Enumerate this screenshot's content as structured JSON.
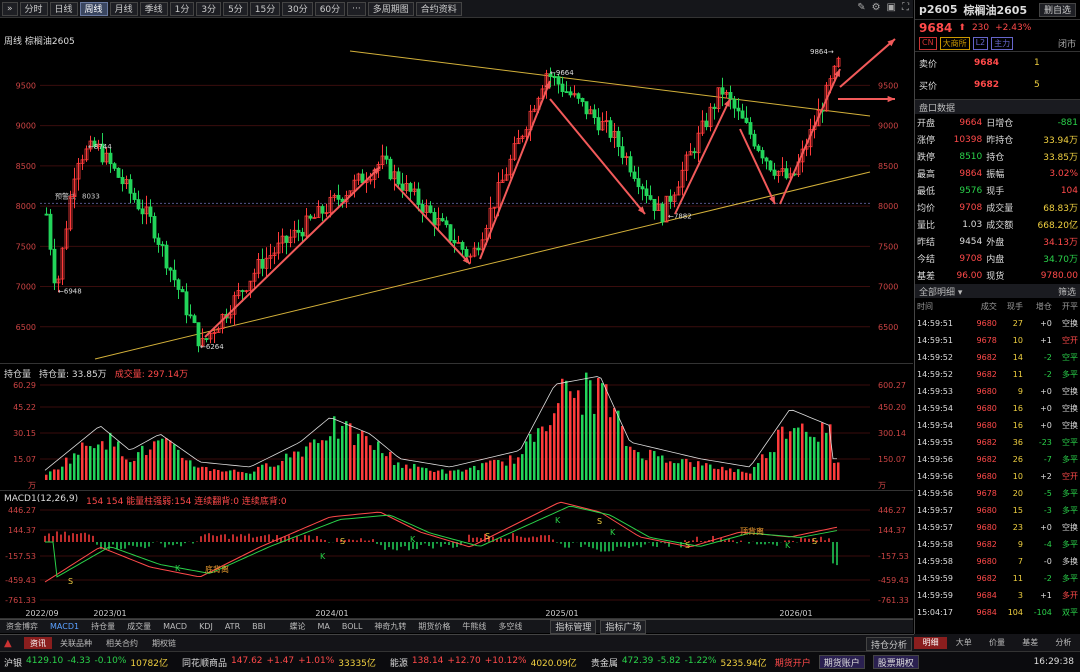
{
  "toolbar": {
    "buttons": [
      "分时",
      "日线",
      "周线",
      "月线",
      "季线",
      "1分",
      "3分",
      "5分",
      "15分",
      "30分",
      "60分",
      "···",
      "多周期图",
      "合约资料"
    ],
    "active": "周线"
  },
  "chart": {
    "title": "周线  棕榈油2605",
    "price_ticks": [
      "9500",
      "9000",
      "8500",
      "8000",
      "7500",
      "7000",
      "6500"
    ],
    "annotations": {
      "high1": "9664",
      "h8744": "8744",
      "low6948": "6948",
      "low6264": "6264",
      "low7882": "7882",
      "hi9864": "9864",
      "pre": "预警线",
      "pre_val": "8033"
    },
    "x_labels": [
      "2022/09",
      "2023/01",
      "2024/01",
      "2025/01",
      "2026/01"
    ]
  },
  "vol": {
    "label": "持仓量",
    "hold": "持仓量: 33.85万",
    "turn": "成交量: 297.14万",
    "left_ticks": [
      "60.29",
      "45.22",
      "30.15",
      "15.07",
      "万"
    ],
    "right_ticks": [
      "600.27",
      "450.20",
      "300.14",
      "150.07",
      "万"
    ]
  },
  "macd": {
    "label": "MACD1(12,26,9)",
    "vals": "154  154  能量柱强弱:154  连续翻背:0  连续底背:0",
    "left_ticks": [
      "446.27",
      "144.37",
      "-157.53",
      "-459.43",
      "-761.33"
    ],
    "right_ticks": [
      "446.27",
      "144.37",
      "-157.53",
      "-459.43",
      "-761.33"
    ],
    "label_dingbeili": "顶背离",
    "label_dibeili": "底背离"
  },
  "bottom_tabs": [
    "资金博弈",
    "MACD1",
    "持仓量",
    "成交量",
    "MACD",
    "KDJ",
    "ATR",
    "BBI"
  ],
  "bottom_tabs2": [
    "蝶论",
    "MA",
    "BOLL",
    "神奇九转",
    "期货价格",
    "牛熊线",
    "多空线"
  ],
  "bottom_right": [
    "指标管理",
    "指标广场"
  ],
  "news": {
    "tabs": [
      "资讯",
      "关联品种",
      "相关合约",
      "期权链"
    ],
    "right": "持仓分析"
  },
  "status": {
    "items": [
      {
        "name": "沪银",
        "price": "4129.10",
        "chg": "-4.33",
        "pct": "-0.10%",
        "amt": "10782亿",
        "dir": "dn"
      },
      {
        "name": "同花顺商品",
        "price": "147.62",
        "chg": "+1.47",
        "pct": "+1.01%",
        "amt": "33335亿",
        "dir": "up"
      },
      {
        "name": "能源",
        "price": "138.14",
        "chg": "+12.70",
        "pct": "+10.12%",
        "amt": "4020.09亿",
        "dir": "up"
      },
      {
        "name": "贵金属",
        "price": "472.39",
        "chg": "-5.82",
        "pct": "-1.22%",
        "amt": "5235.94亿",
        "dir": "dn"
      }
    ],
    "notice": "期货开户",
    "btn1": "期货账户",
    "btn2": "股票期权",
    "time": "16:29:38"
  },
  "quote": {
    "code": "p2605",
    "name": "棕榈油2605",
    "btn": "删自选",
    "price": "9684",
    "chg": "230",
    "pct": "+2.43%",
    "tags": [
      "CN",
      "大商所",
      "L2",
      "主力"
    ],
    "status": "闭市",
    "sell_label": "卖价",
    "sell_price": "9684",
    "sell_vol": "1",
    "buy_label": "买价",
    "buy_price": "9682",
    "buy_vol": "5",
    "panel": "盘口数据",
    "rows": [
      [
        "开盘",
        "9664",
        "日增仓",
        "-881"
      ],
      [
        "涨停",
        "10398",
        "昨持仓",
        "33.94万"
      ],
      [
        "跌停",
        "8510",
        "持仓",
        "33.85万"
      ],
      [
        "最高",
        "9864",
        "振幅",
        "3.02%"
      ],
      [
        "最低",
        "9576",
        "现手",
        "104"
      ],
      [
        "均价",
        "9708",
        "成交量",
        "68.83万"
      ],
      [
        "量比",
        "1.03",
        "成交额",
        "668.20亿"
      ],
      [
        "昨结",
        "9454",
        "外盘",
        "34.13万"
      ],
      [
        "今结",
        "9708",
        "内盘",
        "34.70万"
      ],
      [
        "基差",
        "96.00",
        "现货",
        "9780.00"
      ]
    ],
    "ticks_hdr": "全部明细",
    "filter": "筛选",
    "tick_cols": [
      "时间",
      "成交",
      "现手",
      "增仓",
      "开平"
    ],
    "ticks": [
      [
        "14:59:51",
        "9680",
        "27",
        "+0",
        "空换"
      ],
      [
        "14:59:51",
        "9678",
        "10",
        "+1",
        "空开"
      ],
      [
        "14:59:52",
        "9682",
        "14",
        "-2",
        "空平"
      ],
      [
        "14:59:52",
        "9682",
        "11",
        "-2",
        "多平"
      ],
      [
        "14:59:53",
        "9680",
        "9",
        "+0",
        "空换"
      ],
      [
        "14:59:54",
        "9680",
        "16",
        "+0",
        "空换"
      ],
      [
        "14:59:54",
        "9680",
        "16",
        "+0",
        "空换"
      ],
      [
        "14:59:55",
        "9682",
        "36",
        "-23",
        "空平"
      ],
      [
        "14:59:56",
        "9682",
        "26",
        "-7",
        "多平"
      ],
      [
        "14:59:56",
        "9680",
        "10",
        "+2",
        "空开"
      ],
      [
        "14:59:56",
        "9678",
        "20",
        "-5",
        "多平"
      ],
      [
        "14:59:57",
        "9680",
        "15",
        "-3",
        "多平"
      ],
      [
        "14:59:57",
        "9680",
        "23",
        "+0",
        "空换"
      ],
      [
        "14:59:58",
        "9682",
        "9",
        "-4",
        "多平"
      ],
      [
        "14:59:58",
        "9680",
        "7",
        "-0",
        "多换"
      ],
      [
        "14:59:59",
        "9682",
        "11",
        "-2",
        "多平"
      ],
      [
        "14:59:59",
        "9684",
        "3",
        "+1",
        "多开"
      ],
      [
        "15:04:17",
        "9684",
        "104",
        "-104",
        "双平"
      ]
    ],
    "bottom_tabs": [
      "明细",
      "大单",
      "价量",
      "基差",
      "分析"
    ]
  }
}
